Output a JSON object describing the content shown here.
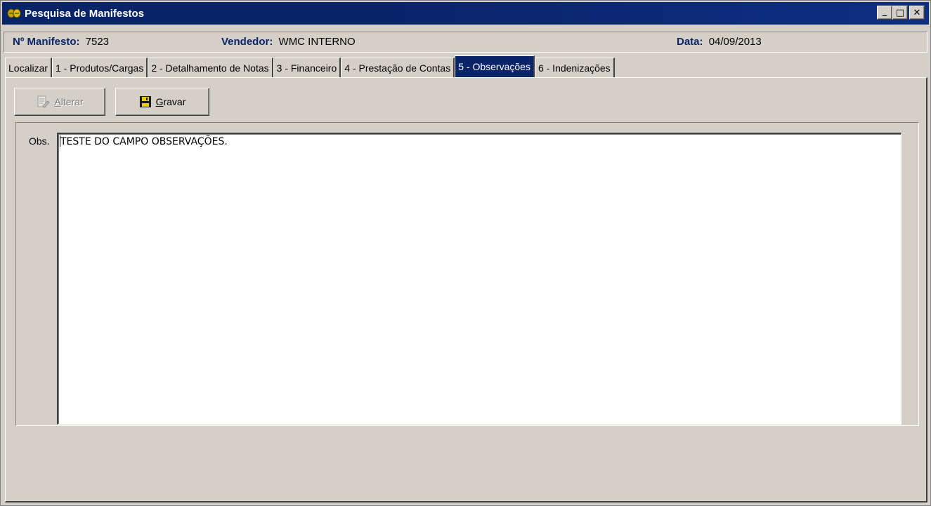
{
  "window": {
    "title": "Pesquisa de Manifestos",
    "minimize_glyph": "_",
    "maximize_glyph": "□",
    "close_glyph": "✕"
  },
  "header": {
    "manifest_label": "Nº Manifesto:",
    "manifest_value": "7523",
    "seller_label": "Vendedor:",
    "seller_value": "WMC INTERNO",
    "date_label": "Data:",
    "date_value": "04/09/2013"
  },
  "tabs": [
    {
      "label": "Localizar",
      "active": false
    },
    {
      "label": "1 - Produtos/Cargas",
      "active": false
    },
    {
      "label": "2 - Detalhamento de Notas",
      "active": false
    },
    {
      "label": "3 - Financeiro",
      "active": false
    },
    {
      "label": "4 - Prestação de Contas",
      "active": false
    },
    {
      "label": "5 - Observações",
      "active": true
    },
    {
      "label": "6 - Indenizações",
      "active": false
    }
  ],
  "toolbar": {
    "alterar_accel": "A",
    "alterar_rest": "lterar",
    "alterar_enabled": false,
    "gravar_accel": "G",
    "gravar_rest": "ravar",
    "gravar_enabled": true
  },
  "observations": {
    "label": "Obs.",
    "value": "TESTE DO CAMPO OBSERVAÇÕES."
  },
  "colors": {
    "titlebar": "#0a246a",
    "face": "#d4d0c8",
    "label_blue": "#0a246a"
  }
}
